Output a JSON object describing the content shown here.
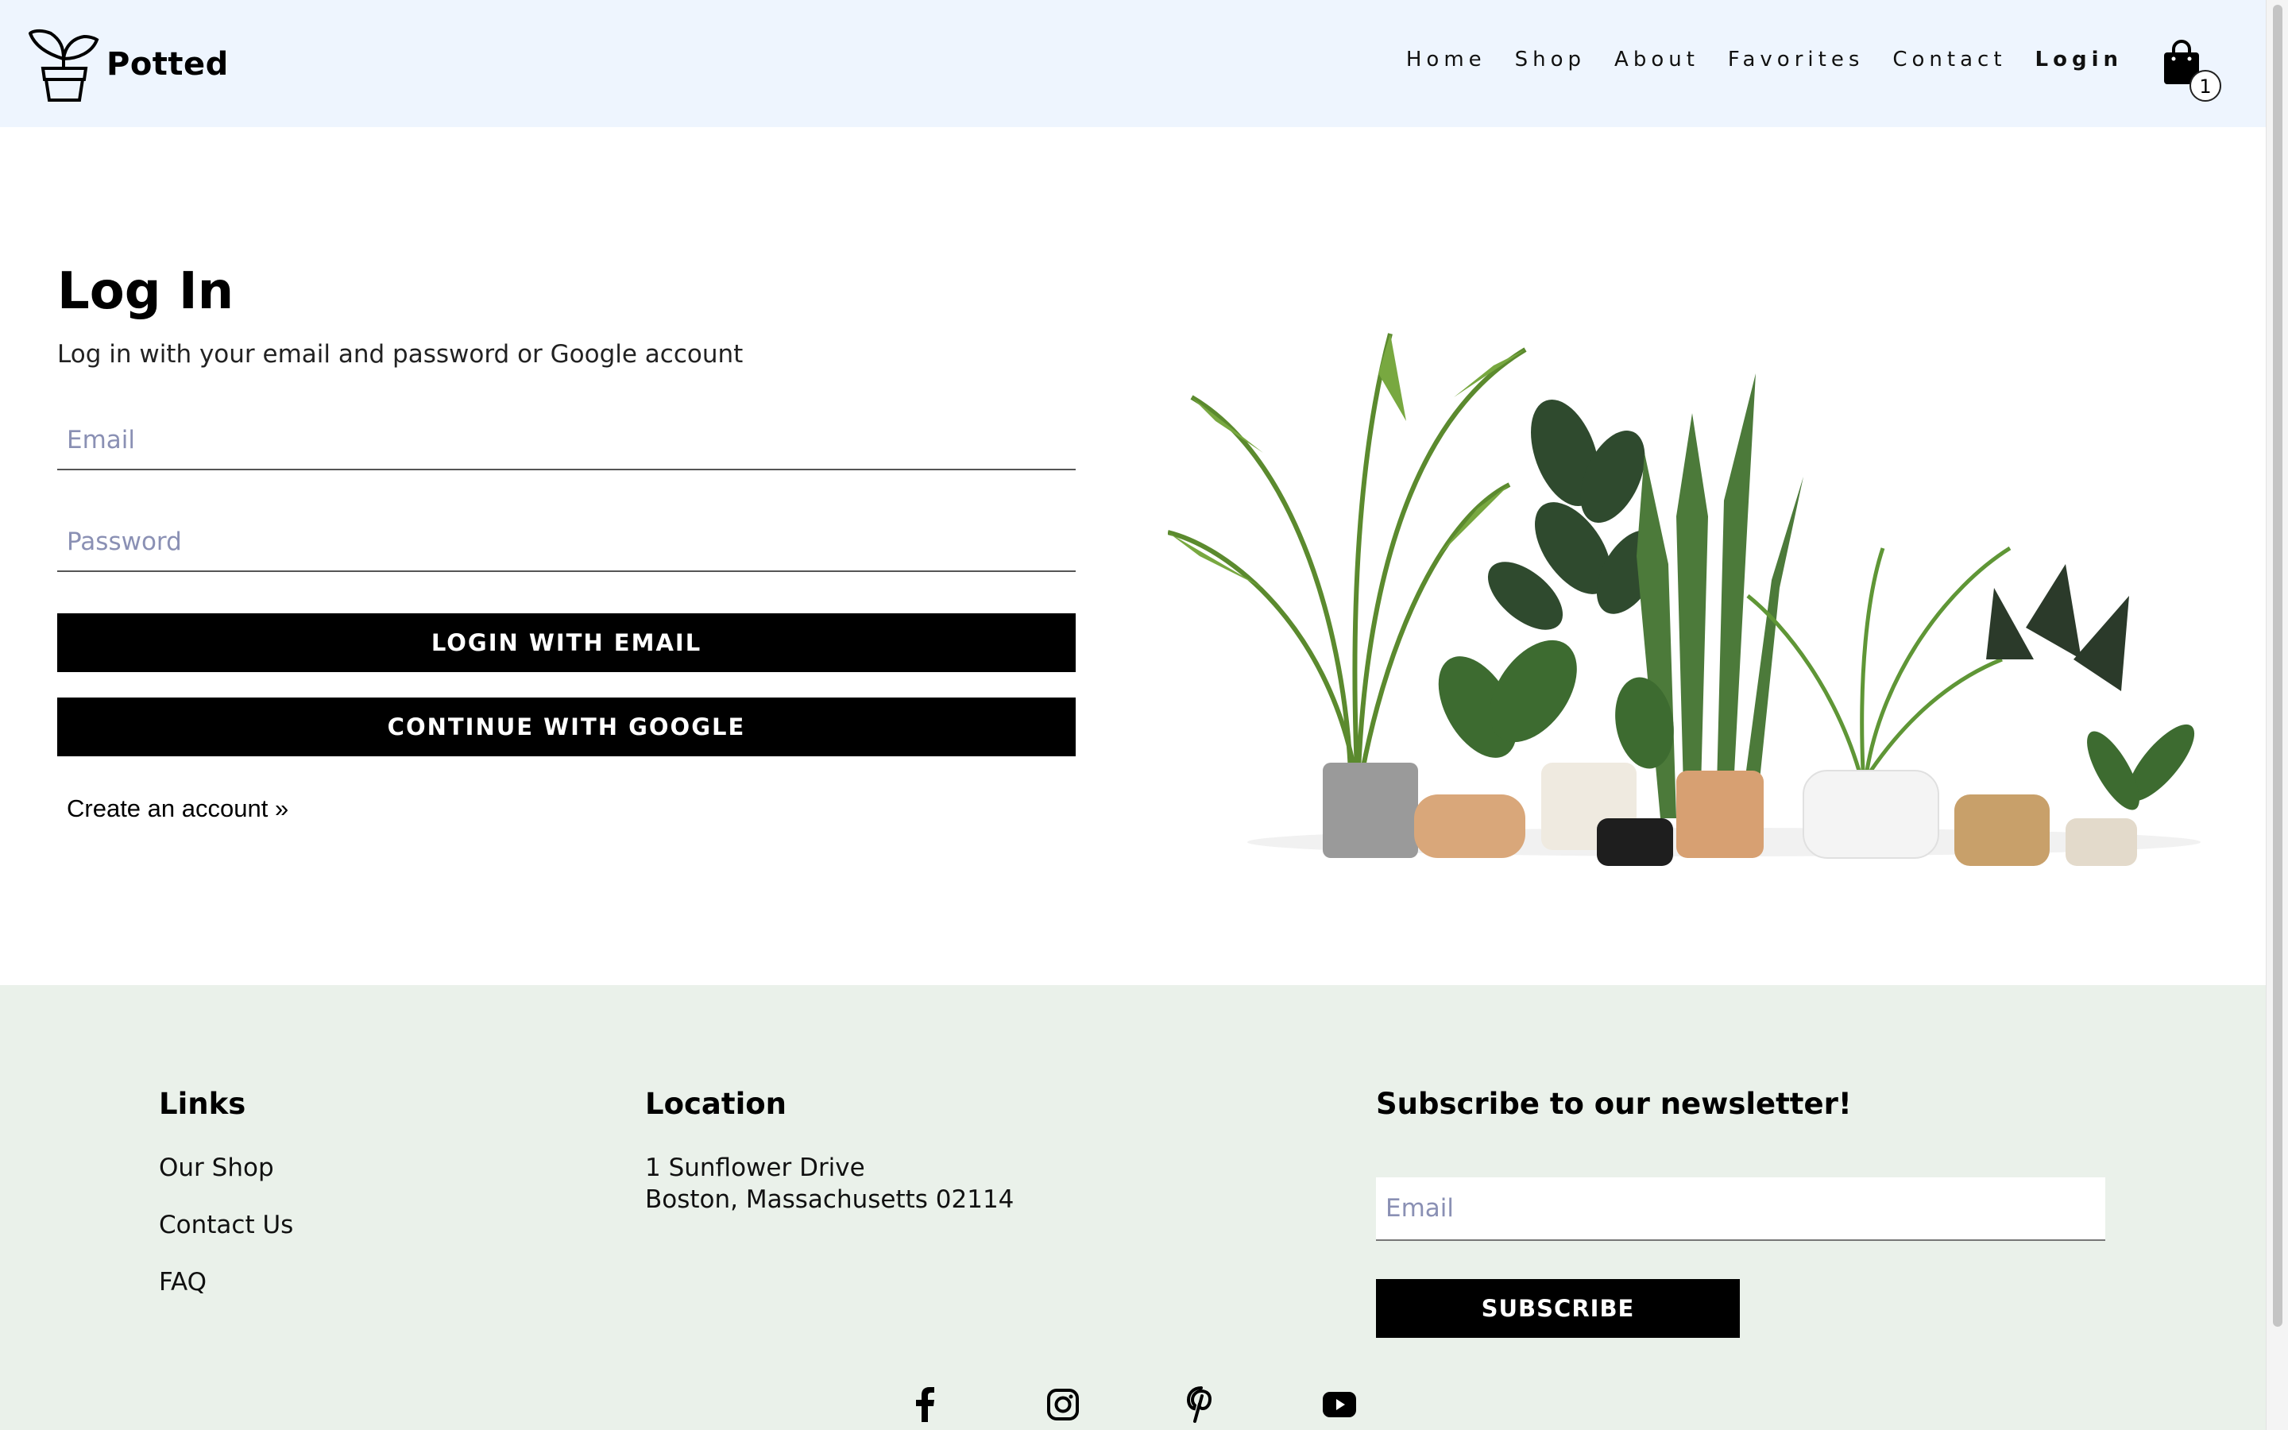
{
  "brand": {
    "name": "Potted"
  },
  "nav": {
    "items": [
      {
        "label": "Home"
      },
      {
        "label": "Shop"
      },
      {
        "label": "About"
      },
      {
        "label": "Favorites"
      },
      {
        "label": "Contact"
      },
      {
        "label": "Login",
        "active": true
      }
    ],
    "cart_count": "1"
  },
  "login": {
    "title": "Log In",
    "subtitle": "Log in with your email and password or Google account",
    "email_placeholder": "Email",
    "password_placeholder": "Password",
    "email_button": "LOGIN WITH EMAIL",
    "google_button": "CONTINUE WITH GOOGLE",
    "create_account": "Create an account »"
  },
  "footer": {
    "links_heading": "Links",
    "links": [
      "Our Shop",
      "Contact Us",
      "FAQ"
    ],
    "location_heading": "Location",
    "address_line1": "1 Sunflower Drive",
    "address_line2": "Boston, Massachusetts 02114",
    "newsletter_heading": "Subscribe to our newsletter!",
    "newsletter_placeholder": "Email",
    "subscribe_button": "SUBSCRIBE",
    "social_icons": [
      "facebook-icon",
      "instagram-icon",
      "pinterest-icon",
      "youtube-icon"
    ]
  },
  "colors": {
    "header_bg": "#eef5fe",
    "footer_bg": "#eaf1ea",
    "button_bg": "#000000",
    "placeholder": "#8a90b4"
  }
}
